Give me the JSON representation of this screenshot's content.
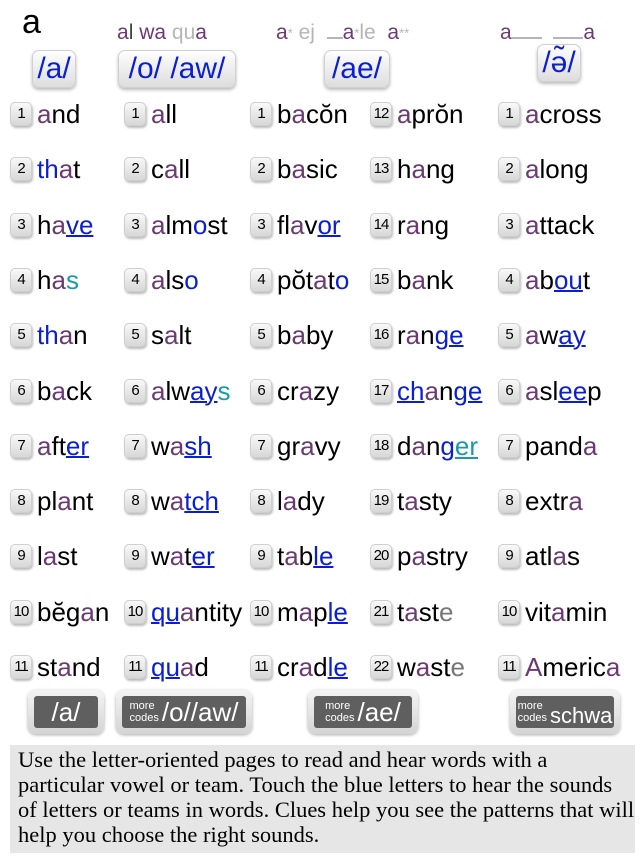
{
  "header": {
    "letter": "a",
    "clues": {
      "col1": [
        {
          "t": "al",
          "c": "p-part"
        },
        {
          "t": " wa",
          "c": "p"
        },
        {
          "t": " qua",
          "c": "g-part"
        }
      ],
      "col2_text": "a* ej",
      "col2b_text": "_a*le",
      "col2c_text": "a**",
      "col3_text": "a___   ___a"
    },
    "sound_buttons": [
      {
        "label": "/a/"
      },
      {
        "label": "/o/ /aw/"
      },
      {
        "label": "/ae/"
      },
      {
        "label": "/ə̃/"
      }
    ]
  },
  "columns": [
    {
      "name": "a-short",
      "words": [
        {
          "n": "1",
          "parts": [
            [
              "a",
              "a"
            ],
            [
              "",
              "nd"
            ]
          ]
        },
        {
          "n": "2",
          "parts": [
            [
              "b",
              "th"
            ],
            [
              "a",
              "a"
            ],
            [
              "",
              "t"
            ]
          ]
        },
        {
          "n": "3",
          "parts": [
            [
              "",
              "h"
            ],
            [
              "a",
              "a"
            ],
            [
              "bu",
              "ve"
            ]
          ]
        },
        {
          "n": "4",
          "parts": [
            [
              "",
              "h"
            ],
            [
              "a",
              "a"
            ],
            [
              "t",
              "s"
            ]
          ]
        },
        {
          "n": "5",
          "parts": [
            [
              "b",
              "th"
            ],
            [
              "a",
              "a"
            ],
            [
              "",
              "n"
            ]
          ]
        },
        {
          "n": "6",
          "parts": [
            [
              "",
              "b"
            ],
            [
              "a",
              "a"
            ],
            [
              "",
              "ck"
            ]
          ]
        },
        {
          "n": "7",
          "parts": [
            [
              "a",
              "a"
            ],
            [
              "",
              "ft"
            ],
            [
              "bu",
              "er"
            ]
          ]
        },
        {
          "n": "8",
          "parts": [
            [
              "",
              "pl"
            ],
            [
              "a",
              "a"
            ],
            [
              "",
              "nt"
            ]
          ]
        },
        {
          "n": "9",
          "parts": [
            [
              "",
              "l"
            ],
            [
              "a",
              "a"
            ],
            [
              "",
              "st"
            ]
          ]
        },
        {
          "n": "10",
          "parts": [
            [
              "",
              "bĕg"
            ],
            [
              "a",
              "a"
            ],
            [
              "",
              "n"
            ]
          ]
        },
        {
          "n": "11",
          "parts": [
            [
              "",
              "st"
            ],
            [
              "a",
              "a"
            ],
            [
              "",
              "nd"
            ]
          ]
        }
      ]
    },
    {
      "name": "o-aw",
      "words": [
        {
          "n": "1",
          "parts": [
            [
              "a",
              "a"
            ],
            [
              "",
              "ll"
            ]
          ]
        },
        {
          "n": "2",
          "parts": [
            [
              "",
              "c"
            ],
            [
              "a",
              "a"
            ],
            [
              "",
              "ll"
            ]
          ]
        },
        {
          "n": "3",
          "parts": [
            [
              "a",
              "a"
            ],
            [
              "",
              "lm"
            ],
            [
              "b",
              "o"
            ],
            [
              "",
              "st"
            ]
          ]
        },
        {
          "n": "4",
          "parts": [
            [
              "a",
              "a"
            ],
            [
              "",
              "ls"
            ],
            [
              "b",
              "o"
            ]
          ]
        },
        {
          "n": "5",
          "parts": [
            [
              "",
              "s"
            ],
            [
              "a",
              "a"
            ],
            [
              "",
              "lt"
            ]
          ]
        },
        {
          "n": "6",
          "parts": [
            [
              "a",
              "a"
            ],
            [
              "",
              "lw"
            ],
            [
              "bu",
              "ay"
            ],
            [
              "t",
              "s"
            ]
          ]
        },
        {
          "n": "7",
          "parts": [
            [
              "",
              "w"
            ],
            [
              "a",
              "a"
            ],
            [
              "bu",
              "sh"
            ]
          ]
        },
        {
          "n": "8",
          "parts": [
            [
              "",
              "w"
            ],
            [
              "a",
              "a"
            ],
            [
              "bu",
              "tch"
            ]
          ]
        },
        {
          "n": "9",
          "parts": [
            [
              "",
              "w"
            ],
            [
              "a",
              "a"
            ],
            [
              "",
              "t"
            ],
            [
              "bu",
              "er"
            ]
          ]
        },
        {
          "n": "10",
          "parts": [
            [
              "bu",
              "qu"
            ],
            [
              "a",
              "a"
            ],
            [
              "",
              "ntity"
            ]
          ]
        },
        {
          "n": "11",
          "parts": [
            [
              "bu",
              "qu"
            ],
            [
              "a",
              "a"
            ],
            [
              "",
              "d"
            ]
          ]
        }
      ]
    },
    {
      "name": "ae-1",
      "words": [
        {
          "n": "1",
          "parts": [
            [
              "",
              "b"
            ],
            [
              "a",
              "a"
            ],
            [
              "",
              "cŏn"
            ]
          ]
        },
        {
          "n": "2",
          "parts": [
            [
              "",
              "b"
            ],
            [
              "a",
              "a"
            ],
            [
              "",
              "sic"
            ]
          ]
        },
        {
          "n": "3",
          "parts": [
            [
              "",
              "fl"
            ],
            [
              "a",
              "a"
            ],
            [
              "",
              "v"
            ],
            [
              "bu",
              "or"
            ]
          ]
        },
        {
          "n": "4",
          "parts": [
            [
              "",
              "pŏt"
            ],
            [
              "a",
              "a"
            ],
            [
              "",
              "t"
            ],
            [
              "b",
              "o"
            ]
          ]
        },
        {
          "n": "5",
          "parts": [
            [
              "",
              "b"
            ],
            [
              "a",
              "a"
            ],
            [
              "",
              "by"
            ]
          ]
        },
        {
          "n": "6",
          "parts": [
            [
              "",
              "cr"
            ],
            [
              "a",
              "a"
            ],
            [
              "",
              "zy"
            ]
          ]
        },
        {
          "n": "7",
          "parts": [
            [
              "",
              "gr"
            ],
            [
              "a",
              "a"
            ],
            [
              "",
              "vy"
            ]
          ]
        },
        {
          "n": "8",
          "parts": [
            [
              "",
              "l"
            ],
            [
              "a",
              "a"
            ],
            [
              "",
              "dy"
            ]
          ]
        },
        {
          "n": "9",
          "parts": [
            [
              "",
              "t"
            ],
            [
              "a",
              "a"
            ],
            [
              "",
              "b"
            ],
            [
              "bu",
              "le"
            ]
          ]
        },
        {
          "n": "10",
          "parts": [
            [
              "",
              "m"
            ],
            [
              "a",
              "a"
            ],
            [
              "",
              "p"
            ],
            [
              "bu",
              "le"
            ]
          ]
        },
        {
          "n": "11",
          "parts": [
            [
              "",
              "cr"
            ],
            [
              "a",
              "a"
            ],
            [
              "",
              "d"
            ],
            [
              "bu",
              "le"
            ]
          ]
        }
      ]
    },
    {
      "name": "ae-2",
      "words": [
        {
          "n": "12",
          "parts": [
            [
              "a",
              "a"
            ],
            [
              "",
              "prŏn"
            ]
          ]
        },
        {
          "n": "13",
          "parts": [
            [
              "",
              "h"
            ],
            [
              "a",
              "a"
            ],
            [
              "",
              "ng"
            ]
          ]
        },
        {
          "n": "14",
          "parts": [
            [
              "",
              "r"
            ],
            [
              "a",
              "a"
            ],
            [
              "",
              "ng"
            ]
          ]
        },
        {
          "n": "15",
          "parts": [
            [
              "",
              "b"
            ],
            [
              "a",
              "a"
            ],
            [
              "",
              "nk"
            ]
          ]
        },
        {
          "n": "16",
          "parts": [
            [
              "",
              "r"
            ],
            [
              "a",
              "a"
            ],
            [
              "",
              "n"
            ],
            [
              "bu",
              "ge"
            ]
          ]
        },
        {
          "n": "17",
          "parts": [
            [
              "bu",
              "ch"
            ],
            [
              "a",
              "a"
            ],
            [
              "",
              "n"
            ],
            [
              "bu",
              "ge"
            ]
          ]
        },
        {
          "n": "18",
          "parts": [
            [
              "",
              "d"
            ],
            [
              "a",
              "a"
            ],
            [
              "",
              "n"
            ],
            [
              "bu",
              "g"
            ],
            [
              "tu",
              "er"
            ]
          ]
        },
        {
          "n": "19",
          "parts": [
            [
              "",
              "t"
            ],
            [
              "a",
              "a"
            ],
            [
              "",
              "sty"
            ]
          ]
        },
        {
          "n": "20",
          "parts": [
            [
              "",
              "p"
            ],
            [
              "a",
              "a"
            ],
            [
              "",
              "stry"
            ]
          ]
        },
        {
          "n": "21",
          "parts": [
            [
              "",
              "t"
            ],
            [
              "a",
              "a"
            ],
            [
              "",
              "st"
            ],
            [
              "gr",
              "e"
            ]
          ]
        },
        {
          "n": "22",
          "parts": [
            [
              "",
              "w"
            ],
            [
              "a",
              "a"
            ],
            [
              "",
              "st"
            ],
            [
              "gr",
              "e"
            ]
          ]
        }
      ]
    },
    {
      "name": "schwa",
      "words": [
        {
          "n": "1",
          "parts": [
            [
              "a",
              "a"
            ],
            [
              "",
              "cross"
            ]
          ]
        },
        {
          "n": "2",
          "parts": [
            [
              "a",
              "a"
            ],
            [
              "",
              "long"
            ]
          ]
        },
        {
          "n": "3",
          "parts": [
            [
              "a",
              "a"
            ],
            [
              "",
              "ttack"
            ]
          ]
        },
        {
          "n": "4",
          "parts": [
            [
              "a",
              "a"
            ],
            [
              "",
              "b"
            ],
            [
              "bu",
              "ou"
            ],
            [
              "",
              "t"
            ]
          ]
        },
        {
          "n": "5",
          "parts": [
            [
              "a",
              "a"
            ],
            [
              "",
              "w"
            ],
            [
              "bu",
              "ay"
            ]
          ]
        },
        {
          "n": "6",
          "parts": [
            [
              "a",
              "a"
            ],
            [
              "",
              "sl"
            ],
            [
              "bu",
              "ee"
            ],
            [
              "",
              "p"
            ]
          ]
        },
        {
          "n": "7",
          "parts": [
            [
              "",
              "pand"
            ],
            [
              "a",
              "a"
            ]
          ]
        },
        {
          "n": "8",
          "parts": [
            [
              "",
              "extr"
            ],
            [
              "a",
              "a"
            ]
          ]
        },
        {
          "n": "9",
          "parts": [
            [
              "",
              "atl"
            ],
            [
              "a",
              "a"
            ],
            [
              "",
              "s"
            ]
          ]
        },
        {
          "n": "10",
          "parts": [
            [
              "",
              "vit"
            ],
            [
              "a",
              "a"
            ],
            [
              "",
              "min"
            ]
          ]
        },
        {
          "n": "11",
          "parts": [
            [
              "a",
              "A"
            ],
            [
              "",
              "meric"
            ],
            [
              "a",
              "a"
            ]
          ]
        }
      ]
    }
  ],
  "footer_buttons": [
    {
      "more": "",
      "label": "/a/"
    },
    {
      "more": "more\ncodes",
      "label": "/o//aw/"
    },
    {
      "more": "more\ncodes",
      "label": "/ae/"
    },
    {
      "more": "more\ncodes",
      "label": "schwa"
    }
  ],
  "info_text": "Use the letter-oriented pages to read and hear words with a particular vowel or team. Touch the blue letters to hear the sounds of letters or teams in words. Clues help you see the patterns that will help you choose the right sounds.",
  "colors": {
    "purple": "#6b3a73",
    "blue": "#0a1fd1",
    "teal": "#1a9aa8",
    "gray": "#b5b5b5"
  }
}
